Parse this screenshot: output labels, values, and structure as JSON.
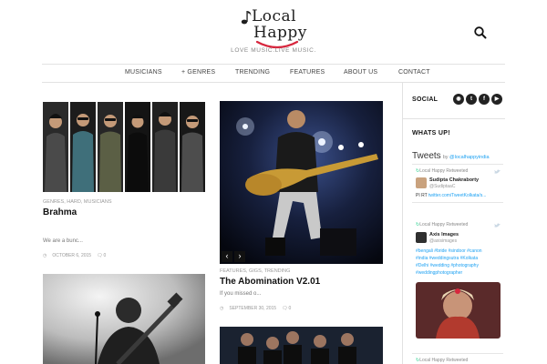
{
  "header": {
    "logo_word1": "Local",
    "logo_word2": "Happy",
    "tagline": "LOVE MUSIC.LIVE MUSIC."
  },
  "nav": {
    "items": [
      "MUSICIANS",
      "+ GENRES",
      "TRENDING",
      "FEATURES",
      "ABOUT US",
      "CONTACT"
    ]
  },
  "posts": [
    {
      "category": "GENRES, HARD, MUSICIANS",
      "title": "Brahma",
      "excerpt": "We are a bunc...",
      "date": "OCTOBER 6, 2015",
      "comments": "0"
    },
    {
      "category": "FEATURES, GIGS, TRENDING",
      "title": "The Abomination V2.01",
      "excerpt": "If you missed o...",
      "date": "SEPTEMBER 30, 2015",
      "comments": "0"
    }
  ],
  "slider": {
    "prev_icon": "chevron-left-icon",
    "next_icon": "chevron-right-icon"
  },
  "sidebar": {
    "social_title": "SOCIAL",
    "social_icons": [
      "instagram-icon",
      "twitter-icon",
      "facebook-icon",
      "youtube-icon"
    ],
    "whats_up_title": "WHATS UP!"
  },
  "tweets": {
    "heading": "Tweets",
    "by": "by",
    "handle": "@localhappyindia",
    "items": [
      {
        "retweeted": "Local Happy Retweeted",
        "name": "Sudipta Chakraborty",
        "user": "@SudiptaaC",
        "text_prefix": "PI RT ",
        "text_link": "twitter.com/TweetKolkata/s..."
      },
      {
        "retweeted": "Local Happy Retweeted",
        "name": "Axis Images",
        "user": "@axisimages",
        "hashtags": [
          "#bengali #bride #sindoor #canon",
          "#india #weddingsutra #Kolkata",
          "#Delhi #wedding #photography",
          "#weddingphotographer"
        ]
      }
    ],
    "third_retweeted": "Local Happy Retweeted"
  },
  "colors": {
    "accent": "#d7263d",
    "twitter_blue": "#1da1f2",
    "text_dark": "#111111",
    "muted": "#999999"
  }
}
